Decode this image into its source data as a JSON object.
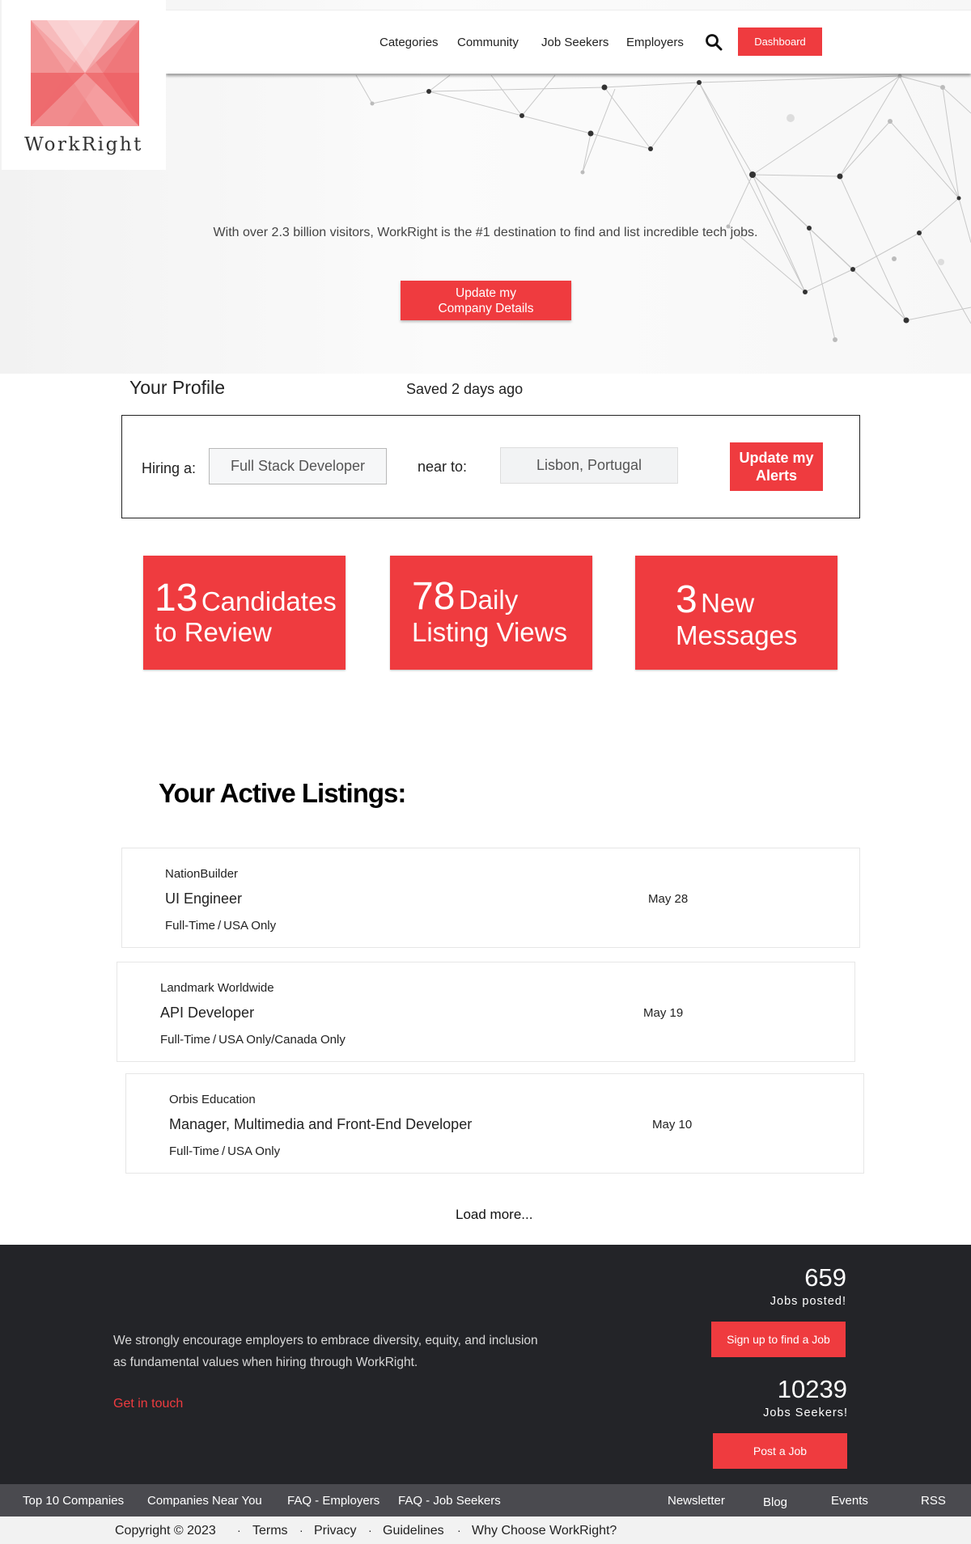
{
  "brand": {
    "name": "WorkRight",
    "accent_color": "#ef3b3f",
    "footer_bg": "#232428"
  },
  "nav": {
    "items": [
      "Categories",
      "Community",
      "Job Seekers",
      "Employers"
    ],
    "search_icon": "search-icon",
    "dashboard_label": "Dashboard"
  },
  "hero": {
    "tagline": "With over 2.3 billion visitors, WorkRight is the #1 destination to find and list incredible tech jobs.",
    "button_line1": "Update my",
    "button_line2": "Company Details"
  },
  "profile": {
    "title": "Your Profile",
    "saved": "Saved 2 days ago",
    "hiring_label": "Hiring a:",
    "hiring_value": "Full Stack Developer",
    "near_label": "near to:",
    "near_value": "Lisbon, Portugal",
    "alerts_line1": "Update my",
    "alerts_line2": "Alerts"
  },
  "stats": [
    {
      "number": "13",
      "word": "Candidates",
      "line2": "to Review"
    },
    {
      "number": "78",
      "word": "Daily",
      "line2": "Listing Views"
    },
    {
      "number": "3",
      "word": "New",
      "line2": "Messages"
    }
  ],
  "listings": {
    "title": "Your Active Listings:",
    "items": [
      {
        "company": "NationBuilder",
        "role": "UI Engineer",
        "meta": "Full-Time / USA Only",
        "date": "May 28"
      },
      {
        "company": "Landmark Worldwide",
        "role": "API Developer",
        "meta": "Full-Time / USA Only/Canada Only",
        "date": "May 19"
      },
      {
        "company": "Orbis Education",
        "role": "Manager, Multimedia and Front-End Developer",
        "meta": "Full-Time / USA Only",
        "date": "May 10"
      }
    ],
    "load_more": "Load more..."
  },
  "footer": {
    "text": "We strongly encourage employers to embrace diversity, equity, and inclusion as fundamental values when hiring through WorkRight.",
    "get_in_touch": "Get in touch",
    "jobs_posted_num": "659",
    "jobs_posted_cap": "Jobs posted!",
    "signup_btn": "Sign up to find a Job",
    "seekers_num": "10239",
    "seekers_cap": "Jobs Seekers!",
    "post_btn": "Post a Job"
  },
  "footer_nav": {
    "left": [
      "Top 10 Companies",
      "Companies Near You",
      "FAQ - Employers",
      "FAQ - Job Seekers"
    ],
    "right": [
      "Newsletter",
      "Blog",
      "Events",
      "RSS"
    ]
  },
  "bottom": {
    "copyright": "Copyright © 2023",
    "links": [
      "Terms",
      "Privacy",
      "Guidelines",
      "Why Choose WorkRight?"
    ]
  }
}
